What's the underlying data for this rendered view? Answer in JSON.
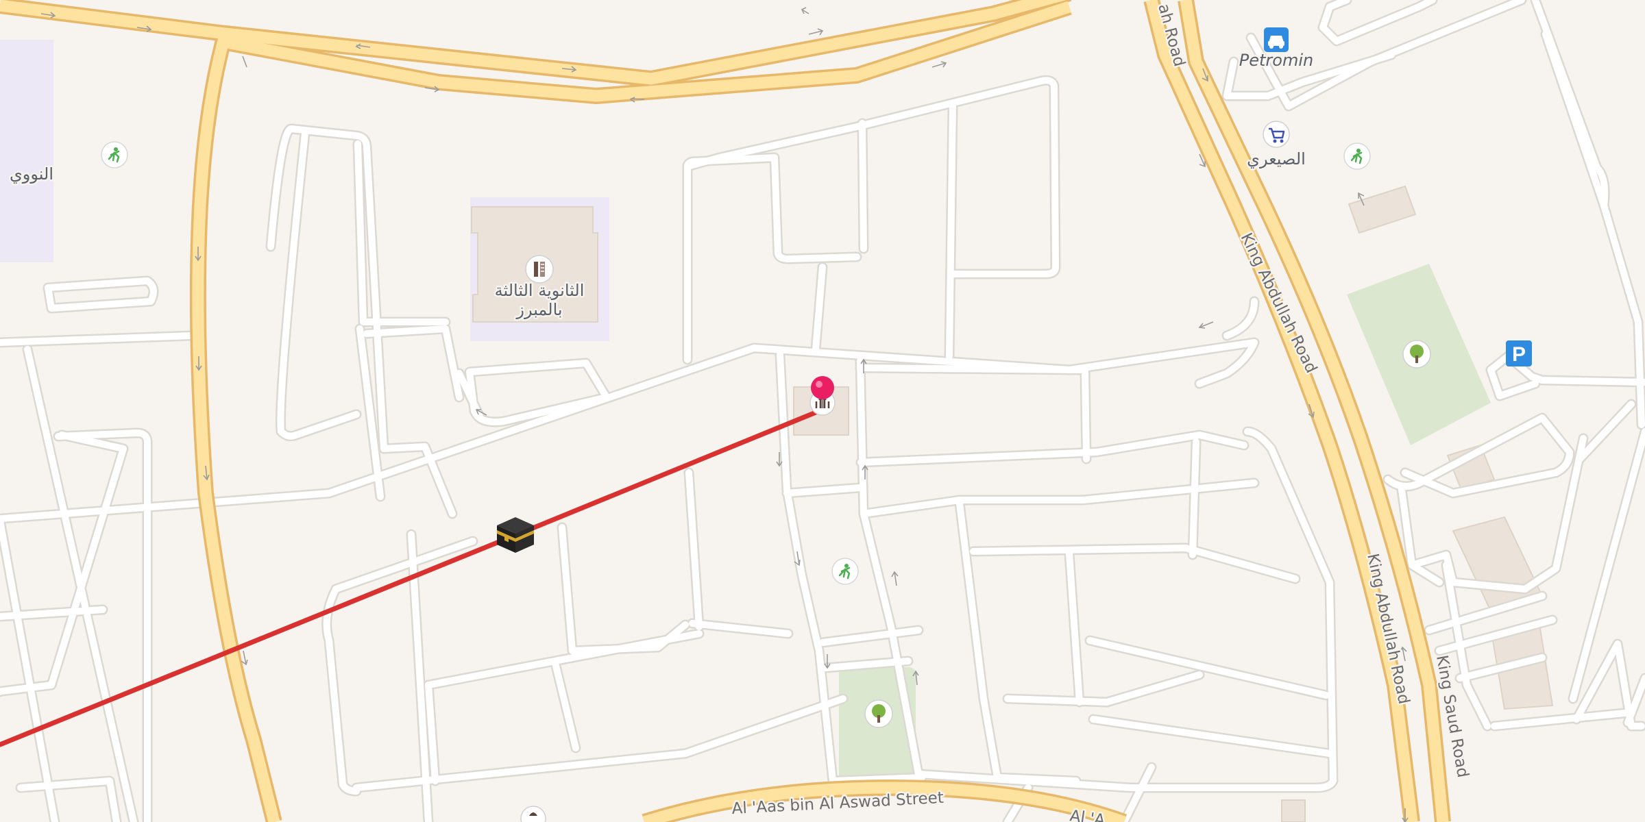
{
  "map": {
    "colors": {
      "background": "#f7f4ef",
      "street_fill": "#ffffff",
      "street_edge": "#dcd8d2",
      "major_road_fill": "#fde2a0",
      "major_road_edge": "#e7b86a",
      "park": "#dbe8cf",
      "school_area": "#ece8f6",
      "building": "#ebe3d9",
      "route_line": "#d9312f",
      "pin": "#e91e63",
      "service_icon": "#2f8be0"
    },
    "road_labels": {
      "king_abdullah_top": "ah Road",
      "king_abdullah_mid": "King Abdullah Road",
      "king_abdullah_low": "King Abdullah Road",
      "king_saud": "King Saud Road",
      "al_aas": "Al 'Aas bin Al Aswad Street",
      "al_aas_fragment": "Al 'A"
    },
    "poi": {
      "school_name_line1": "الثانوية الثالثة",
      "school_name_line2": "بالمبرز",
      "left_edge_label": "النووي",
      "petromin": "Petromin",
      "supermarket": "الصيعري"
    },
    "icons": {
      "destination_pin": "map-pin",
      "kaaba": "kaaba-qibla-marker",
      "mosque": "mosque",
      "school": "school",
      "playground": "playground",
      "park": "tree",
      "parking": "parking",
      "fuel": "car-service",
      "shop": "shopping-cart"
    },
    "parking_glyph": "P"
  }
}
